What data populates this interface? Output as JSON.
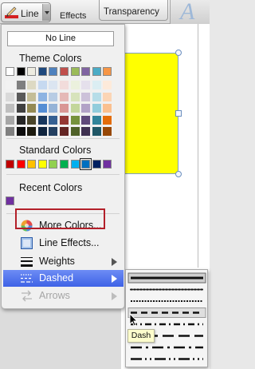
{
  "ribbon": {
    "line_label": "Line",
    "effects_label": "Effects",
    "transparency_label": "Transparency"
  },
  "menu": {
    "no_line_label": "No Line",
    "theme_colors_label": "Theme Colors",
    "standard_colors_label": "Standard Colors",
    "recent_colors_label": "Recent Colors",
    "theme_colors_top": [
      "#ffffff",
      "#000000",
      "#eeece1",
      "#1f497d",
      "#4f81bd",
      "#c0504d",
      "#9bbb59",
      "#8064a2",
      "#4bacc6",
      "#f79646"
    ],
    "theme_colors_shades": [
      [
        "#f2f2f2",
        "#d9d9d9",
        "#bfbfbf",
        "#a6a6a6",
        "#808080"
      ],
      [
        "#7f7f7f",
        "#595959",
        "#404040",
        "#262626",
        "#0d0d0d"
      ],
      [
        "#ddd9c3",
        "#c4bd97",
        "#948a54",
        "#4a452a",
        "#1d1b10"
      ],
      [
        "#c6d9f0",
        "#8db3e2",
        "#548dd4",
        "#17365d",
        "#0f243e"
      ],
      [
        "#dbe5f1",
        "#b8cce4",
        "#95b3d7",
        "#366092",
        "#244061"
      ],
      [
        "#f2dcdb",
        "#e5b9b7",
        "#d99694",
        "#953734",
        "#632423"
      ],
      [
        "#ebf1dd",
        "#d7e3bc",
        "#c3d69b",
        "#76923c",
        "#4f6128"
      ],
      [
        "#e5e0ec",
        "#ccc1d9",
        "#b2a2c7",
        "#5f497a",
        "#3f3151"
      ],
      [
        "#dbeef3",
        "#b7dde8",
        "#92cddc",
        "#31859b",
        "#205867"
      ],
      [
        "#fdeada",
        "#fbd5b5",
        "#fac08f",
        "#e36c09",
        "#974806"
      ]
    ],
    "standard_colors": [
      "#c00000",
      "#ff0000",
      "#ffc000",
      "#ffff00",
      "#92d050",
      "#00b050",
      "#00b0f0",
      "#0070c0",
      "#002060",
      "#7030a0"
    ],
    "standard_selected_index": 7,
    "recent_colors": [
      "#7030a0"
    ],
    "more_colors_label": "More Colors...",
    "line_effects_label": "Line Effects...",
    "weights_label": "Weights",
    "dashed_label": "Dashed",
    "arrows_label": "Arrows"
  },
  "dash_submenu": {
    "options": [
      "solid",
      "round-dot",
      "square-dot",
      "dash",
      "dash-dot",
      "long-dash",
      "long-dash-dot",
      "long-dash-dot-dot"
    ],
    "selected_index": 0,
    "hover_index": 3,
    "tooltip": "Dash"
  },
  "colors": {
    "highlight": "#4a6ff0",
    "annotation_box": "#b3202a",
    "shape_fill": "#ffff00"
  }
}
